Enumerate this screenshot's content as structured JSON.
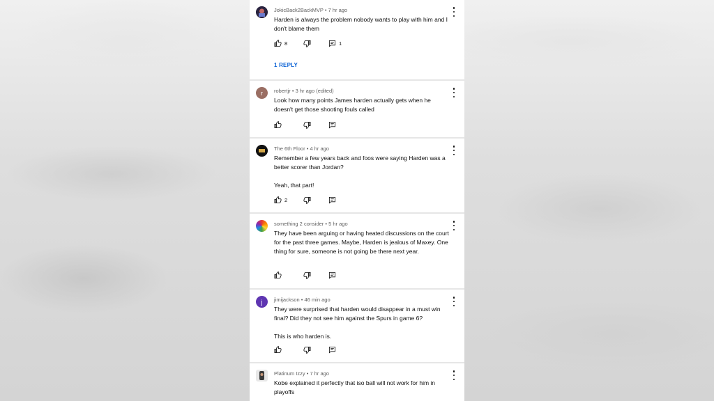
{
  "comments": [
    {
      "author": "JokicBack2BackMVP",
      "time": "7 hr ago",
      "text": "Harden is always the problem nobody wants to play with him and I don't blame them",
      "likes": "8",
      "replies": "1",
      "reply_link": "1 REPLY",
      "avatar_color": "#2a2440",
      "avatar_letter": ""
    },
    {
      "author": "robertjr",
      "time": "3 hr ago (edited)",
      "text": "Look how many points James harden actually gets when he doesn't get those shooting fouls called",
      "likes": "",
      "replies": "",
      "avatar_color": "#9a6e63",
      "avatar_letter": "r"
    },
    {
      "author": "The 6th Floor",
      "time": "4 hr ago",
      "text": "Remember a few years back and foos were saying Harden was a better scorer than Jordan?\n\nYeah, that part!",
      "likes": "2",
      "replies": "",
      "avatar_color": "#111111",
      "avatar_letter": ""
    },
    {
      "author": "something 2 consider",
      "time": "5 hr ago",
      "text": "They have been arguing or having heated discussions on the court for the past three games.  Maybe, Harden is jealous of Maxey. One thing for sure, someone is not going be there next year.",
      "likes": "",
      "replies": "",
      "avatar_color": "#e0602f",
      "avatar_letter": ""
    },
    {
      "author": "jimijackson",
      "time": "46 min ago",
      "text": "They were surprised that harden would disappear in a must win final? Did they not see him against the Spurs in game 6?\n\nThis is who harden is.",
      "likes": "",
      "replies": "",
      "avatar_color": "#5e35b1",
      "avatar_letter": "j"
    },
    {
      "author": "Platinum Izzy",
      "time": "7 hr ago",
      "text": "Kobe explained it perfectly that iso ball will not work for him in playoffs",
      "likes": "",
      "replies": "",
      "avatar_color": "#3b3b3b",
      "avatar_letter": ""
    }
  ],
  "meta_separator": "•",
  "icons": {
    "like": "thumbs-up-icon",
    "dislike": "thumbs-down-icon",
    "reply": "reply-icon",
    "more": "more-vert-icon"
  },
  "colors": {
    "link": "#065fd4",
    "text": "#0f0f0f",
    "meta": "#606060"
  }
}
